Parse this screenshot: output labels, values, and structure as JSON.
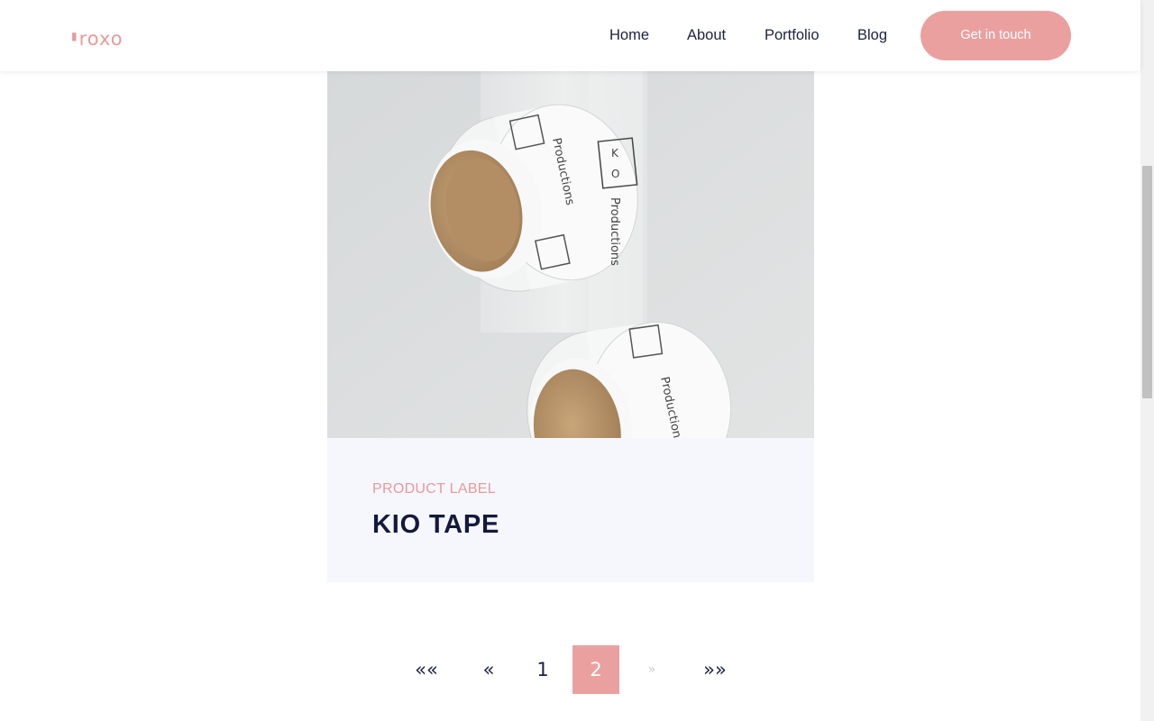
{
  "header": {
    "logo": "roxo",
    "nav": [
      "Home",
      "About",
      "Portfolio",
      "Blog"
    ],
    "cta": "Get in touch"
  },
  "card": {
    "label": "PRODUCT LABEL",
    "title": "KIO TAPE",
    "image_text_boxes": [
      "K",
      "O"
    ],
    "image_brand": "Productions"
  },
  "pagination": {
    "first": "««",
    "prev": "«",
    "pages": [
      "1",
      "2"
    ],
    "current": "2",
    "next": "»",
    "last": "»»"
  },
  "colors": {
    "accent": "#eba0a0",
    "text_dark": "#141a3c",
    "card_bg": "#f6f7fc"
  }
}
